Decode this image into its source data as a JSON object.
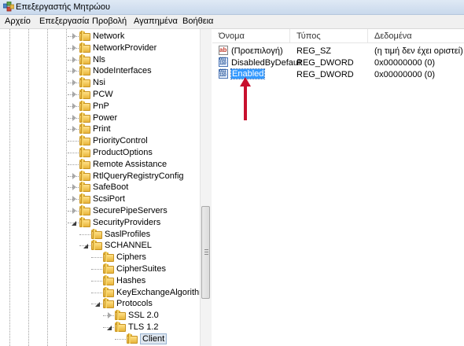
{
  "window": {
    "title": "Επεξεργαστής Μητρώου"
  },
  "menu": [
    "Αρχείο",
    "Επεξεργασία",
    "Προβολή",
    "Αγαπημένα",
    "Βοήθεια"
  ],
  "tree": [
    {
      "label": "Network",
      "state": "collapsed",
      "depth": 0
    },
    {
      "label": "NetworkProvider",
      "state": "collapsed",
      "depth": 0
    },
    {
      "label": "Nls",
      "state": "collapsed",
      "depth": 0
    },
    {
      "label": "NodeInterfaces",
      "state": "collapsed",
      "depth": 0
    },
    {
      "label": "Nsi",
      "state": "collapsed",
      "depth": 0
    },
    {
      "label": "PCW",
      "state": "collapsed",
      "depth": 0
    },
    {
      "label": "PnP",
      "state": "collapsed",
      "depth": 0
    },
    {
      "label": "Power",
      "state": "collapsed",
      "depth": 0
    },
    {
      "label": "Print",
      "state": "collapsed",
      "depth": 0
    },
    {
      "label": "PriorityControl",
      "state": "none",
      "depth": 0
    },
    {
      "label": "ProductOptions",
      "state": "none",
      "depth": 0
    },
    {
      "label": "Remote Assistance",
      "state": "none",
      "depth": 0
    },
    {
      "label": "RtlQueryRegistryConfig",
      "state": "collapsed",
      "depth": 0
    },
    {
      "label": "SafeBoot",
      "state": "collapsed",
      "depth": 0
    },
    {
      "label": "ScsiPort",
      "state": "collapsed",
      "depth": 0
    },
    {
      "label": "SecurePipeServers",
      "state": "collapsed",
      "depth": 0
    },
    {
      "label": "SecurityProviders",
      "state": "expanded",
      "depth": 0
    },
    {
      "label": "SaslProfiles",
      "state": "none",
      "depth": 1
    },
    {
      "label": "SCHANNEL",
      "state": "expanded",
      "depth": 1
    },
    {
      "label": "Ciphers",
      "state": "none",
      "depth": 2
    },
    {
      "label": "CipherSuites",
      "state": "none",
      "depth": 2
    },
    {
      "label": "Hashes",
      "state": "none",
      "depth": 2
    },
    {
      "label": "KeyExchangeAlgorithms",
      "state": "none",
      "depth": 2
    },
    {
      "label": "Protocols",
      "state": "expanded",
      "depth": 2
    },
    {
      "label": "SSL 2.0",
      "state": "collapsed",
      "depth": 3
    },
    {
      "label": "TLS 1.2",
      "state": "expanded",
      "depth": 3
    },
    {
      "label": "Client",
      "state": "none",
      "depth": 4,
      "selected": true
    }
  ],
  "values": {
    "columns": [
      "Όνομα",
      "Τύπος",
      "Δεδομένα"
    ],
    "rows": [
      {
        "icon": "string-value-icon",
        "name": "(Προεπιλογή)",
        "type": "REG_SZ",
        "data": "(η τιμή δεν έχει οριστεί)"
      },
      {
        "icon": "dword-value-icon",
        "name": "DisabledByDefault",
        "type": "REG_DWORD",
        "data": "0x00000000 (0)"
      },
      {
        "icon": "dword-value-icon",
        "name": "Enabled",
        "type": "REG_DWORD",
        "data": "0x00000000 (0)",
        "selected": true
      }
    ]
  },
  "colors": {
    "annotation_arrow": "#c8102e",
    "selection": "#3399ff"
  }
}
